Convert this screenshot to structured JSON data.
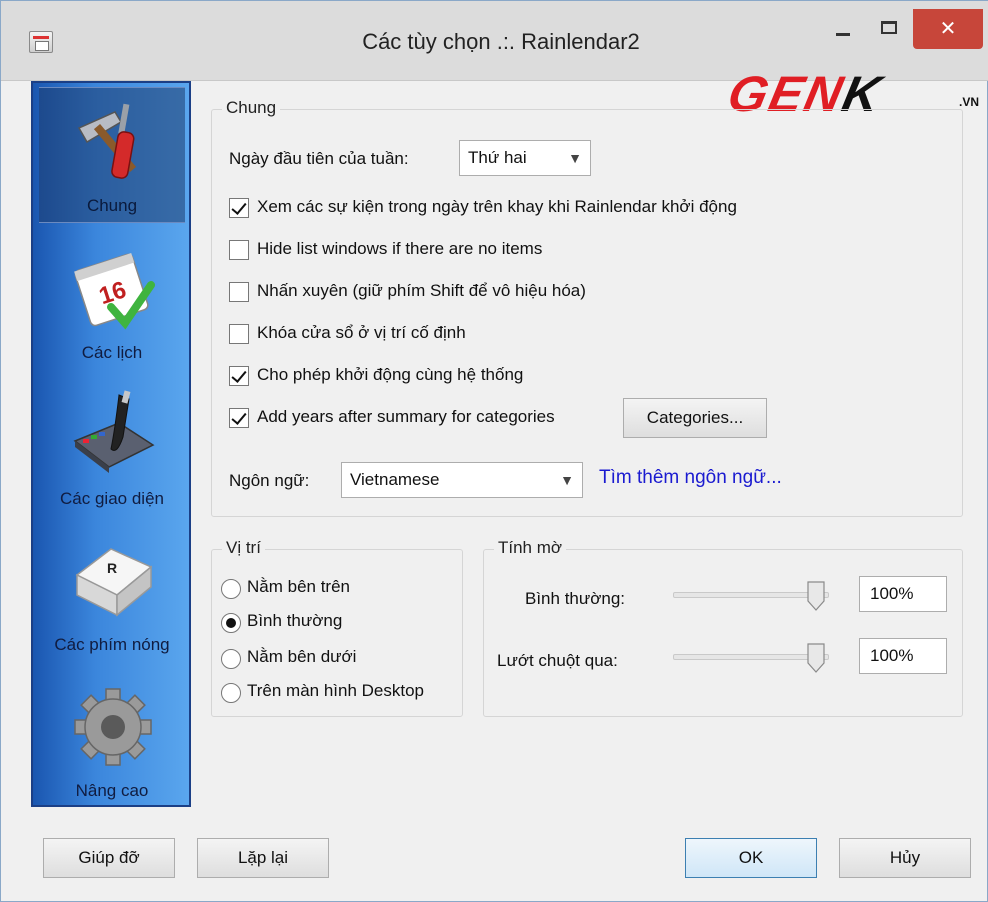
{
  "window": {
    "title": "Các tùy chọn .:. Rainlendar2"
  },
  "logo": {
    "text_main": "GEN",
    "text_k": "K",
    "text_sub": ".VN"
  },
  "sidebar": {
    "items": [
      {
        "label": "Chung",
        "icon": "tools-icon",
        "active": true
      },
      {
        "label": "Các lịch",
        "icon": "calendar-icon",
        "active": false,
        "badge": "16"
      },
      {
        "label": "Các giao diện",
        "icon": "paintbrush-icon",
        "active": false
      },
      {
        "label": "Các phím nóng",
        "icon": "keyboard-key-icon",
        "active": false,
        "key": "R"
      },
      {
        "label": "Nâng cao",
        "icon": "gear-icon",
        "active": false
      }
    ]
  },
  "general": {
    "legend": "Chung",
    "first_day_label": "Ngày đầu tiên của tuần:",
    "first_day_value": "Thứ hai",
    "checkboxes": [
      {
        "label": "Xem các sự kiện trong ngày trên khay khi Rainlendar khởi động",
        "checked": true
      },
      {
        "label": "Hide list windows if there are no items",
        "checked": false
      },
      {
        "label": "Nhấn xuyên (giữ phím Shift để vô hiệu hóa)",
        "checked": false
      },
      {
        "label": "Khóa cửa sổ ở vị trí cố định",
        "checked": false
      },
      {
        "label": "Cho phép khởi động cùng hệ thống",
        "checked": true
      },
      {
        "label": "Add years after summary for categories",
        "checked": true
      }
    ],
    "categories_button": "Categories...",
    "language_label": "Ngôn ngữ:",
    "language_value": "Vietnamese",
    "find_more_link": "Tìm thêm ngôn ngữ..."
  },
  "position": {
    "legend": "Vị trí",
    "options": [
      {
        "label": "Nằm bên trên",
        "selected": false
      },
      {
        "label": "Bình thường",
        "selected": true
      },
      {
        "label": "Nằm bên dưới",
        "selected": false
      },
      {
        "label": "Trên màn hình Desktop",
        "selected": false
      }
    ]
  },
  "opacity": {
    "legend": "Tính mờ",
    "normal_label": "Bình thường:",
    "normal_value": "100%",
    "normal_level": 1.0,
    "hover_label": "Lướt chuột qua:",
    "hover_value": "100%",
    "hover_level": 1.0
  },
  "footer": {
    "help": "Giúp đỡ",
    "reset": "Lặp lại",
    "ok": "OK",
    "cancel": "Hủy"
  },
  "colors": {
    "sidebar": "#3b86dc",
    "link": "#1a1ad0",
    "close": "#c7463a",
    "logo": "#e01e24"
  }
}
